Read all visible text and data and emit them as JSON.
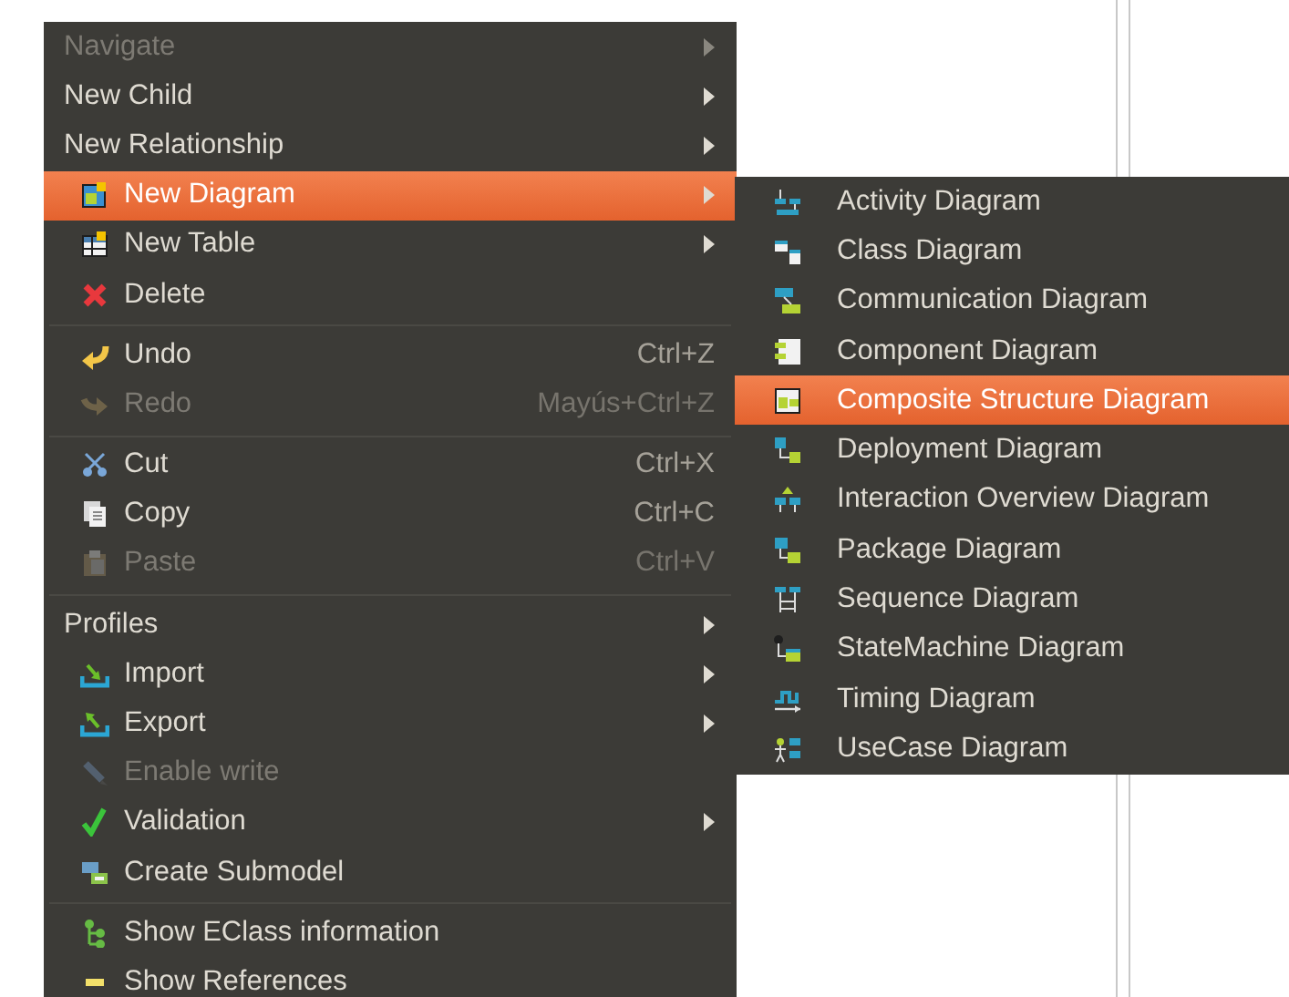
{
  "context_menu": {
    "groups": [
      {
        "items": [
          {
            "label": "Navigate",
            "kind": "plain",
            "disabled": true,
            "selected": false,
            "submenu": true
          },
          {
            "label": "New Child",
            "kind": "plain",
            "disabled": false,
            "selected": false,
            "submenu": true
          },
          {
            "label": "New Relationship",
            "kind": "plain",
            "disabled": false,
            "selected": false,
            "submenu": true
          },
          {
            "label": "New Diagram",
            "kind": "new-diagram",
            "disabled": false,
            "selected": true,
            "submenu": true
          },
          {
            "label": "New Table",
            "kind": "new-table",
            "disabled": false,
            "selected": false,
            "submenu": true
          },
          {
            "label": "Delete",
            "kind": "delete",
            "disabled": false,
            "selected": false,
            "submenu": false
          }
        ]
      },
      {
        "items": [
          {
            "label": "Undo",
            "kind": "undo",
            "shortcut": "Ctrl+Z",
            "disabled": false,
            "selected": false,
            "submenu": false
          },
          {
            "label": "Redo",
            "kind": "redo",
            "shortcut": "Mayús+Ctrl+Z",
            "disabled": true,
            "selected": false,
            "submenu": false
          }
        ]
      },
      {
        "items": [
          {
            "label": "Cut",
            "kind": "cut",
            "shortcut": "Ctrl+X",
            "disabled": false,
            "selected": false,
            "submenu": false
          },
          {
            "label": "Copy",
            "kind": "copy",
            "shortcut": "Ctrl+C",
            "disabled": false,
            "selected": false,
            "submenu": false
          },
          {
            "label": "Paste",
            "kind": "paste",
            "shortcut": "Ctrl+V",
            "disabled": true,
            "selected": false,
            "submenu": false
          }
        ]
      },
      {
        "items": [
          {
            "label": "Profiles",
            "kind": "plain",
            "disabled": false,
            "selected": false,
            "submenu": true
          },
          {
            "label": "Import",
            "kind": "import",
            "disabled": false,
            "selected": false,
            "submenu": true
          },
          {
            "label": "Export",
            "kind": "export",
            "disabled": false,
            "selected": false,
            "submenu": true
          },
          {
            "label": "Enable write",
            "kind": "pencil",
            "disabled": true,
            "selected": false,
            "submenu": false
          },
          {
            "label": "Validation",
            "kind": "check",
            "disabled": false,
            "selected": false,
            "submenu": true
          },
          {
            "label": "Create Submodel",
            "kind": "submodel",
            "disabled": false,
            "selected": false,
            "submenu": false
          }
        ]
      },
      {
        "items": [
          {
            "label": "Show EClass information",
            "kind": "tree",
            "disabled": false,
            "selected": false,
            "submenu": false
          },
          {
            "label": "Show References",
            "kind": "references",
            "disabled": false,
            "selected": false,
            "submenu": false
          }
        ]
      }
    ]
  },
  "submenu": {
    "items": [
      {
        "label": "Activity Diagram",
        "kind": "activity",
        "selected": false
      },
      {
        "label": "Class Diagram",
        "kind": "class",
        "selected": false
      },
      {
        "label": "Communication Diagram",
        "kind": "communication",
        "selected": false
      },
      {
        "label": "Component Diagram",
        "kind": "component",
        "selected": false
      },
      {
        "label": "Composite Structure Diagram",
        "kind": "composite",
        "selected": true
      },
      {
        "label": "Deployment Diagram",
        "kind": "deployment",
        "selected": false
      },
      {
        "label": "Interaction Overview Diagram",
        "kind": "interaction",
        "selected": false
      },
      {
        "label": "Package Diagram",
        "kind": "package",
        "selected": false
      },
      {
        "label": "Sequence Diagram",
        "kind": "sequence",
        "selected": false
      },
      {
        "label": "StateMachine Diagram",
        "kind": "statemachine",
        "selected": false
      },
      {
        "label": "Timing Diagram",
        "kind": "timing",
        "selected": false
      },
      {
        "label": "UseCase Diagram",
        "kind": "usecase",
        "selected": false
      }
    ]
  }
}
